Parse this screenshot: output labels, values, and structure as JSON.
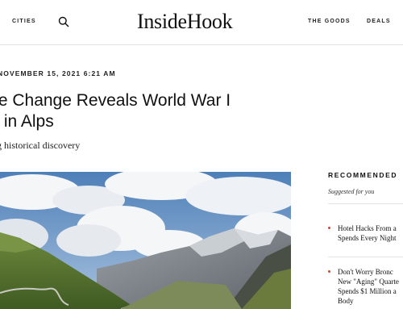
{
  "header": {
    "cities_label": "CITIES",
    "logo_text": "InsideHook",
    "goods_label": "THE GOODS",
    "deals_label": "DEALS"
  },
  "article": {
    "dateline": "NOVEMBER 15, 2021 6:21 AM",
    "headline_line1": "te Change Reveals World War I",
    "headline_line2": "r in Alps",
    "subhead": "g historical discovery"
  },
  "sidebar": {
    "title": "RECOMMENDED",
    "subtitle": "Suggested for you",
    "items": [
      {
        "line1": "Hotel Hacks From a",
        "line2": "Spends Every Night"
      },
      {
        "line1": "Don't Worry Bronc",
        "line2": "New \"Aging\" Quarte",
        "line3": "Spends $1 Million a",
        "line4": "Body"
      }
    ]
  },
  "colors": {
    "accent_dot": "#d9412b"
  },
  "icons": {
    "search": "search-icon"
  }
}
